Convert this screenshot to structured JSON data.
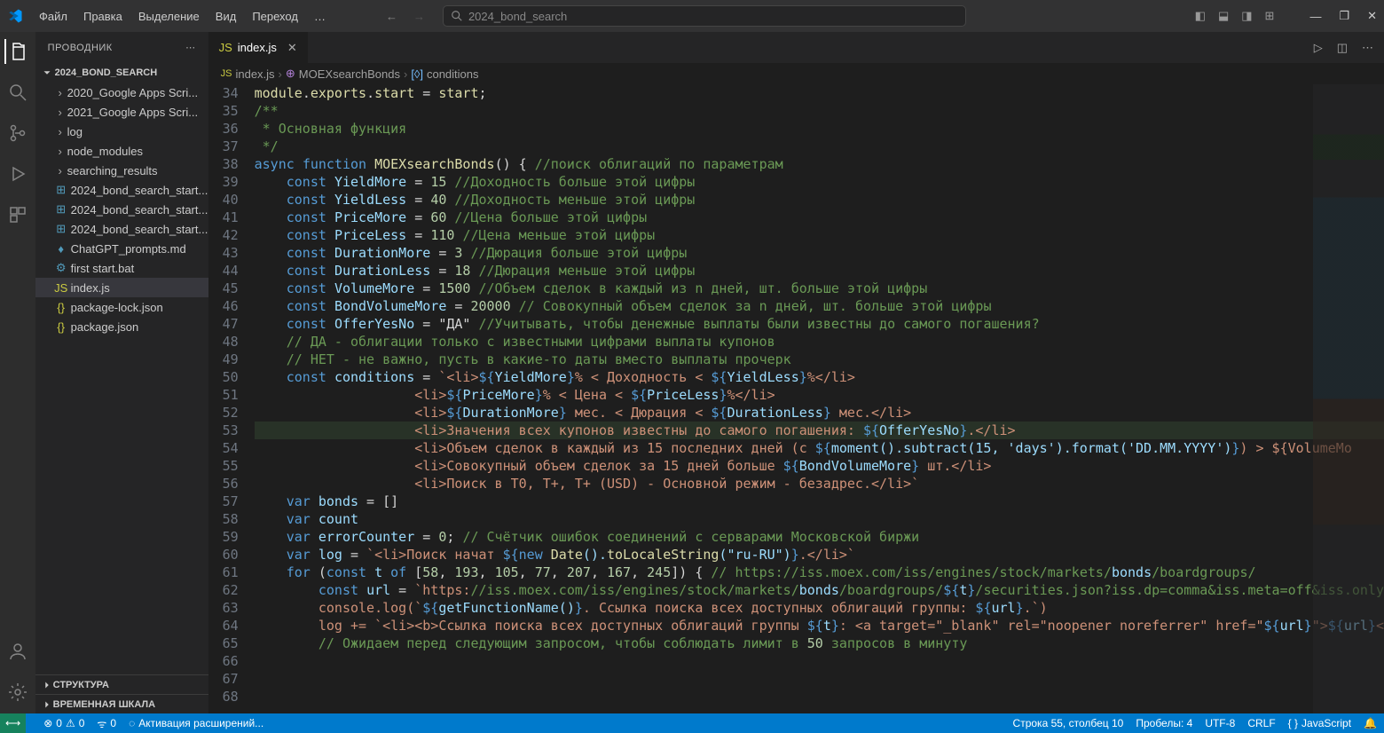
{
  "titlebar": {
    "menus": [
      "Файл",
      "Правка",
      "Выделение",
      "Вид",
      "Переход",
      "…"
    ],
    "search": "2024_bond_search"
  },
  "sidebar": {
    "title": "ПРОВОДНИК",
    "root": "2024_BOND_SEARCH",
    "items": [
      {
        "type": "folder",
        "label": "2020_Google Apps Scri..."
      },
      {
        "type": "folder",
        "label": "2021_Google Apps Scri..."
      },
      {
        "type": "folder",
        "label": "log"
      },
      {
        "type": "folder",
        "label": "node_modules"
      },
      {
        "type": "folder",
        "label": "searching_results"
      },
      {
        "type": "file",
        "icon": "win",
        "label": "2024_bond_search_start..."
      },
      {
        "type": "file",
        "icon": "win",
        "label": "2024_bond_search_start..."
      },
      {
        "type": "file",
        "icon": "win",
        "label": "2024_bond_search_start..."
      },
      {
        "type": "file",
        "icon": "md",
        "label": "ChatGPT_prompts.md"
      },
      {
        "type": "file",
        "icon": "bat",
        "label": "first start.bat"
      },
      {
        "type": "file",
        "icon": "js",
        "label": "index.js",
        "selected": true
      },
      {
        "type": "file",
        "icon": "json",
        "label": "package-lock.json"
      },
      {
        "type": "file",
        "icon": "json",
        "label": "package.json"
      }
    ],
    "sections": [
      "СТРУКТУРА",
      "ВРЕМЕННАЯ ШКАЛА"
    ]
  },
  "tabs": {
    "file": "index.js"
  },
  "breadcrumbs": [
    "index.js",
    "MOEXsearchBonds",
    "conditions"
  ],
  "lines_start": 34,
  "code": [
    "module.exports.start = start;",
    "",
    "/**",
    " * Основная функция",
    " */",
    "",
    "async function MOEXsearchBonds() { //поиск облигаций по параметрам",
    "    const YieldMore = 15 //Доходность больше этой цифры",
    "    const YieldLess = 40 //Доходность меньше этой цифры",
    "    const PriceMore = 60 //Цена больше этой цифры",
    "    const PriceLess = 110 //Цена меньше этой цифры",
    "    const DurationMore = 3 //Дюрация больше этой цифры",
    "    const DurationLess = 18 //Дюрация меньше этой цифры",
    "    const VolumeMore = 1500 //Объем сделок в каждый из n дней, шт. больше этой цифры",
    "    const BondVolumeMore = 20000 // Совокупный объем сделок за n дней, шт. больше этой цифры",
    "    const OfferYesNo = \"ДА\" //Учитывать, чтобы денежные выплаты были известны до самого погашения?",
    "    // ДА - облигации только с известными цифрами выплаты купонов",
    "    // НЕТ - не важно, пусть в какие-то даты вместо выплаты прочерк",
    "    const conditions = `<li>${YieldMore}% < Доходность < ${YieldLess}%</li>",
    "                    <li>${PriceMore}% < Цена < ${PriceLess}%</li>",
    "                    <li>${DurationMore} мес. < Дюрация < ${DurationLess} мес.</li>",
    "                    <li>Значения всех купонов известны до самого погашения: ${OfferYesNo}.</li>",
    "                    <li>Объем сделок в каждый из 15 последних дней (с ${moment().subtract(15, 'days').format('DD.MM.YYYY')}) > ${VolumeMo",
    "                    <li>Совокупный объем сделок за 15 дней больше ${BondVolumeMore} шт.</li>",
    "                    <li>Поиск в T0, T+, T+ (USD) - Основной режим - безадрес.</li>`",
    "    var bonds = []",
    "    var count",
    "    var errorCounter = 0; // Счётчик ошибок соединений с серварами Московской биржи",
    "    var log = `<li>Поиск начат ${new Date().toLocaleString(\"ru-RU\")}.</li>`",
    "    for (const t of [58, 193, 105, 77, 207, 167, 245]) { // https://iss.moex.com/iss/engines/stock/markets/bonds/boardgroups/",
    "        const url = `https://iss.moex.com/iss/engines/stock/markets/bonds/boardgroups/${t}/securities.json?iss.dp=comma&iss.meta=off&iss.only",
    "        console.log(`${getFunctionName()}. Ссылка поиска всех доступных облигаций группы: ${url}.`)",
    "        log += `<li><b>Ссылка поиска всех доступных облигаций группы ${t}: <a target=\"_blank\" rel=\"noopener noreferrer\" href=\"${url}\">${url}<",
    "",
    "        // Ожидаем перед следующим запросом, чтобы соблюдать лимит в 50 запросов в минуту"
  ],
  "statusbar": {
    "errors": "0",
    "warnings": "0",
    "ports": "0",
    "activating": "Активация расширений...",
    "cursor": "Строка 55, столбец 10",
    "spaces": "Пробелы: 4",
    "encoding": "UTF-8",
    "eol": "CRLF",
    "lang": "JavaScript"
  }
}
